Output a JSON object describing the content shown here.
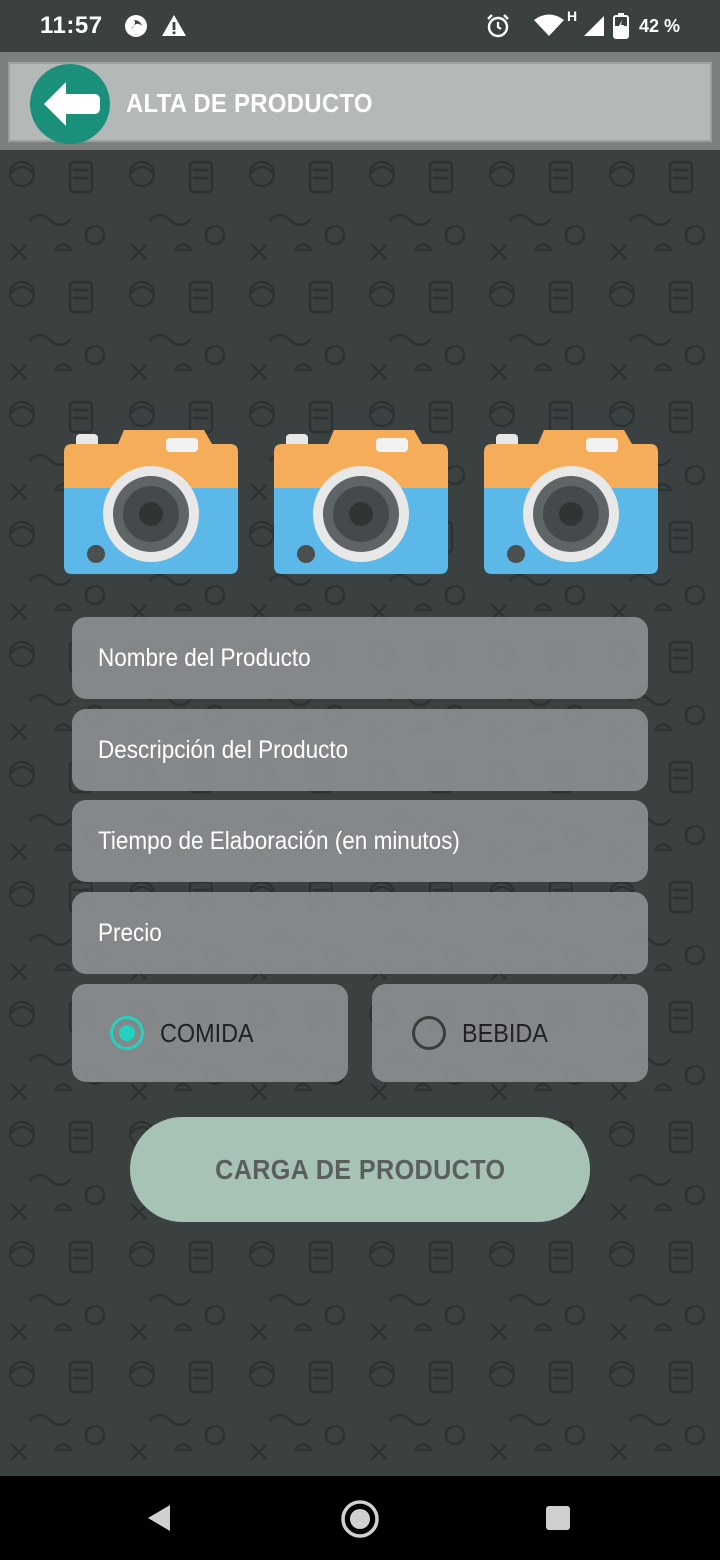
{
  "status_bar": {
    "time": "11:57",
    "battery_percent": "42 %",
    "network_label": "H",
    "icons": [
      "firefox-icon",
      "warning-icon",
      "alarm-icon",
      "wifi-icon",
      "signal-icon",
      "battery-icon"
    ]
  },
  "app_bar": {
    "title": "ALTA DE PRODUCTO",
    "back_icon": "arrow-left-icon",
    "back_color": "#1a8f7a"
  },
  "photos": {
    "icons": [
      "camera-icon",
      "camera-icon",
      "camera-icon"
    ]
  },
  "form": {
    "name_placeholder": "Nombre del Producto",
    "description_placeholder": "Descripción del Producto",
    "time_placeholder": "Tiempo de Elaboración (en minutos)",
    "price_placeholder": "Precio",
    "type_options": [
      {
        "label": "COMIDA",
        "selected": true
      },
      {
        "label": "BEBIDA",
        "selected": false
      }
    ],
    "accent_color": "#22d3c0"
  },
  "submit": {
    "label": "CARGA DE PRODUCTO",
    "color": "#a7c3b6"
  },
  "nav_bar": {
    "icons": [
      "back-triangle-icon",
      "home-circle-icon",
      "recents-square-icon"
    ]
  }
}
